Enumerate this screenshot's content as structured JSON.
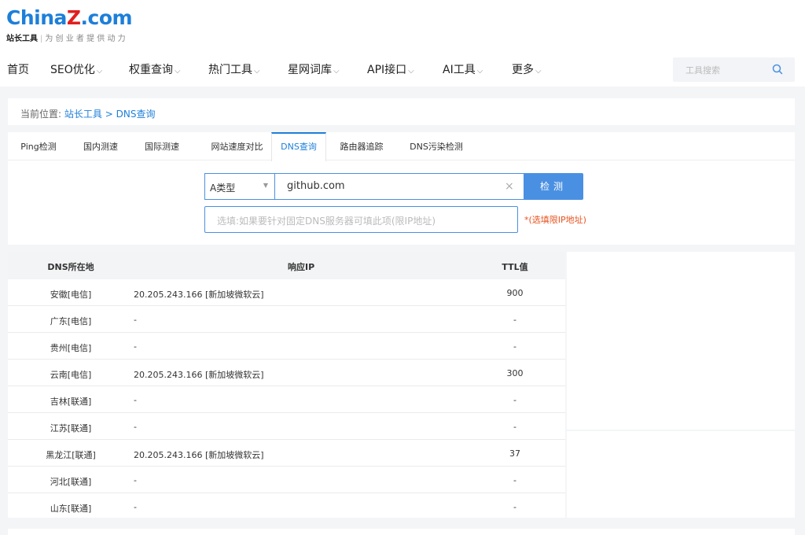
{
  "brand": {
    "logo_part1": "China",
    "logo_part2": "Z",
    "logo_part3": ".com",
    "sub_bold": "站长工具",
    "sub_slogan": "为 创 业 者 提 供 动 力"
  },
  "nav": {
    "items": [
      {
        "label": "首页",
        "has_caret": false
      },
      {
        "label": "SEO优化",
        "has_caret": true
      },
      {
        "label": "权重查询",
        "has_caret": true
      },
      {
        "label": "热门工具",
        "has_caret": true
      },
      {
        "label": "星网词库",
        "has_caret": true
      },
      {
        "label": "API接口",
        "has_caret": true
      },
      {
        "label": "AI工具",
        "has_caret": true
      },
      {
        "label": "更多",
        "has_caret": true
      }
    ],
    "caret_glyph": "⌵",
    "search_placeholder": "工具搜索"
  },
  "breadcrumb": {
    "label": "当前位置:",
    "home": "站长工具",
    "separator": ">",
    "current": "DNS查询"
  },
  "tabs": [
    {
      "label": "Ping检测",
      "active": false
    },
    {
      "label": "国内测速",
      "active": false
    },
    {
      "label": "国际测速",
      "active": false
    },
    {
      "label": "网站速度对比",
      "active": false
    },
    {
      "label": "DNS查询",
      "active": true
    },
    {
      "label": "路由器追踪",
      "active": false
    },
    {
      "label": "DNS污染检测",
      "active": false
    }
  ],
  "form": {
    "record_type": "A类型",
    "domain_value": "github.com",
    "clear_glyph": "×",
    "detect_label": "检测",
    "server_placeholder": "选填:如果要针对固定DNS服务器可填此项(限IP地址)",
    "hint": "*(选填限IP地址)"
  },
  "results": {
    "columns": [
      "DNS所在地",
      "响应IP",
      "TTL值"
    ],
    "rows": [
      {
        "location": "安徽[电信]",
        "ip": "20.205.243.166 [新加坡微软云]",
        "ttl": "900"
      },
      {
        "location": "广东[电信]",
        "ip": "-",
        "ttl": "-"
      },
      {
        "location": "贵州[电信]",
        "ip": "-",
        "ttl": "-"
      },
      {
        "location": "云南[电信]",
        "ip": "20.205.243.166 [新加坡微软云]",
        "ttl": "300"
      },
      {
        "location": "吉林[联通]",
        "ip": "-",
        "ttl": "-"
      },
      {
        "location": "江苏[联通]",
        "ip": "-",
        "ttl": "-"
      },
      {
        "location": "黑龙江[联通]",
        "ip": "20.205.243.166 [新加坡微软云]",
        "ttl": "37"
      },
      {
        "location": "河北[联通]",
        "ip": "-",
        "ttl": "-"
      },
      {
        "location": "山东[联通]",
        "ip": "-",
        "ttl": "-"
      }
    ]
  },
  "colors": {
    "accent": "#4a90e2",
    "link": "#1d7fd9",
    "brand_red": "#e11f1f",
    "hint": "#e8531f"
  }
}
